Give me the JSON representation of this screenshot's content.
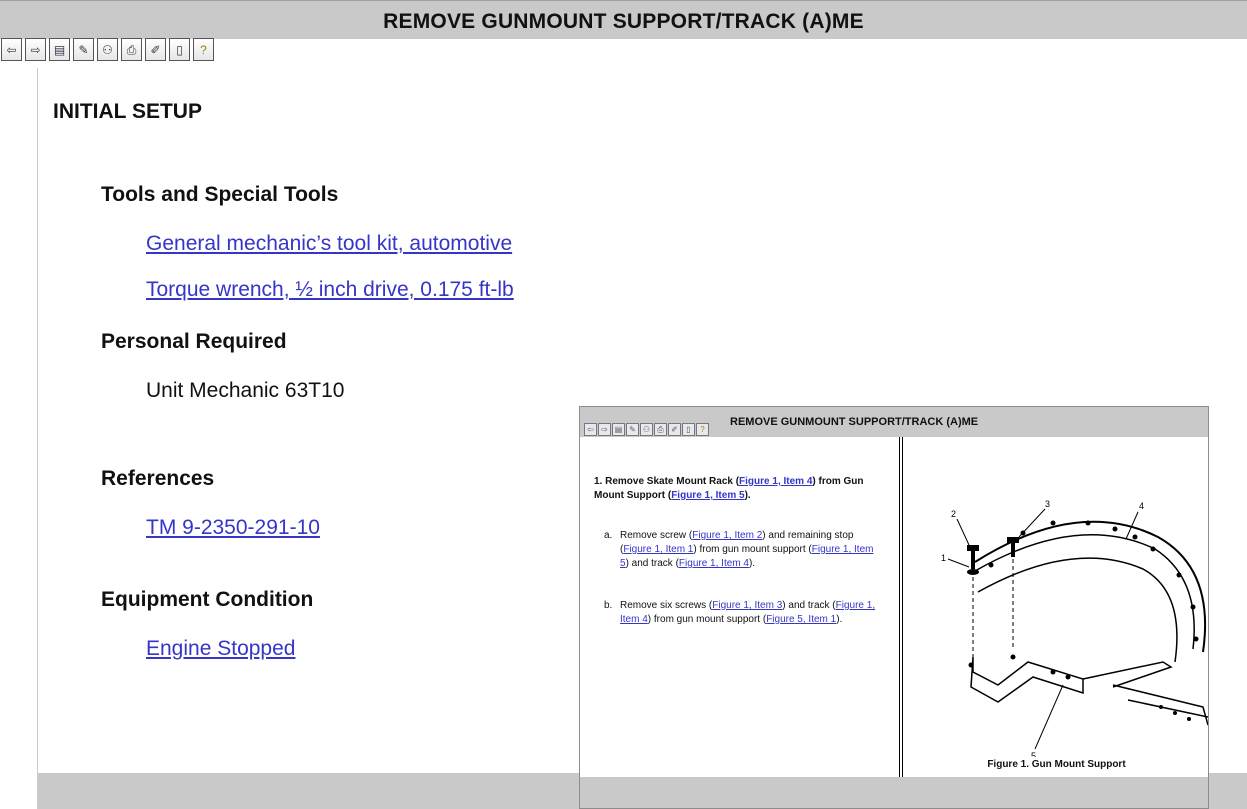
{
  "main": {
    "title": "REMOVE GUNMOUNT SUPPORT/TRACK (A)ME",
    "toolbar": [
      {
        "name": "back-icon",
        "glyph": "⇦"
      },
      {
        "name": "forward-icon",
        "glyph": "⇨"
      },
      {
        "name": "save-icon",
        "glyph": "▤"
      },
      {
        "name": "pencil-icon",
        "glyph": "✎"
      },
      {
        "name": "binoculars-icon",
        "glyph": "⚇"
      },
      {
        "name": "print-icon",
        "glyph": "⎙"
      },
      {
        "name": "edit-icon",
        "glyph": "✐"
      },
      {
        "name": "bookmark-icon",
        "glyph": "▯"
      },
      {
        "name": "help-bulb-icon",
        "glyph": "?"
      }
    ],
    "initial_setup": "INITIAL SETUP",
    "tools_heading": "Tools and Special Tools",
    "tool_1": "General mechanic’s tool kit, automotive",
    "tool_2": "Torque wrench, ½ inch drive, 0.175 ft-lb",
    "personal_heading": "Personal Required",
    "personal_1": "Unit Mechanic 63T10",
    "references_heading": "References",
    "reference_1": "TM 9-2350-291-10",
    "equipment_heading": "Equipment Condition",
    "equipment_1": "Engine Stopped"
  },
  "nested": {
    "title": "REMOVE GUNMOUNT SUPPORT/TRACK (A)ME",
    "step1": {
      "prefix": "1. Remove Skate Mount Rack (",
      "link1": "Figure 1, Item 4",
      "mid": ") from Gun Mount Support (",
      "link2": "Figure 1, Item 5",
      "suffix": ")."
    },
    "step_a": {
      "letter": "a.",
      "t1": "Remove screw (",
      "l1": "Figure 1, Item 2",
      "t2": ") and remaining stop (",
      "l2": "Figure 1, Item 1",
      "t3": ") from gun mount support (",
      "l3": "Figure 1, Item 5",
      "t4": ") and track (",
      "l4": "Figure 1, Item 4",
      "t5": ")."
    },
    "step_b": {
      "letter": "b.",
      "t1": "Remove six screws (",
      "l1": "Figure 1, Item 3",
      "t2": ") and track (",
      "l2": "Figure 1, Item 4",
      "t3": ") from gun mount support (",
      "l3": "Figure 5, Item 1",
      "t4": ")."
    },
    "figure": {
      "caption": "Figure 1. Gun Mount Support",
      "callout_1": "1",
      "callout_2": "2",
      "callout_3": "3",
      "callout_4": "4",
      "callout_5": "5"
    }
  }
}
